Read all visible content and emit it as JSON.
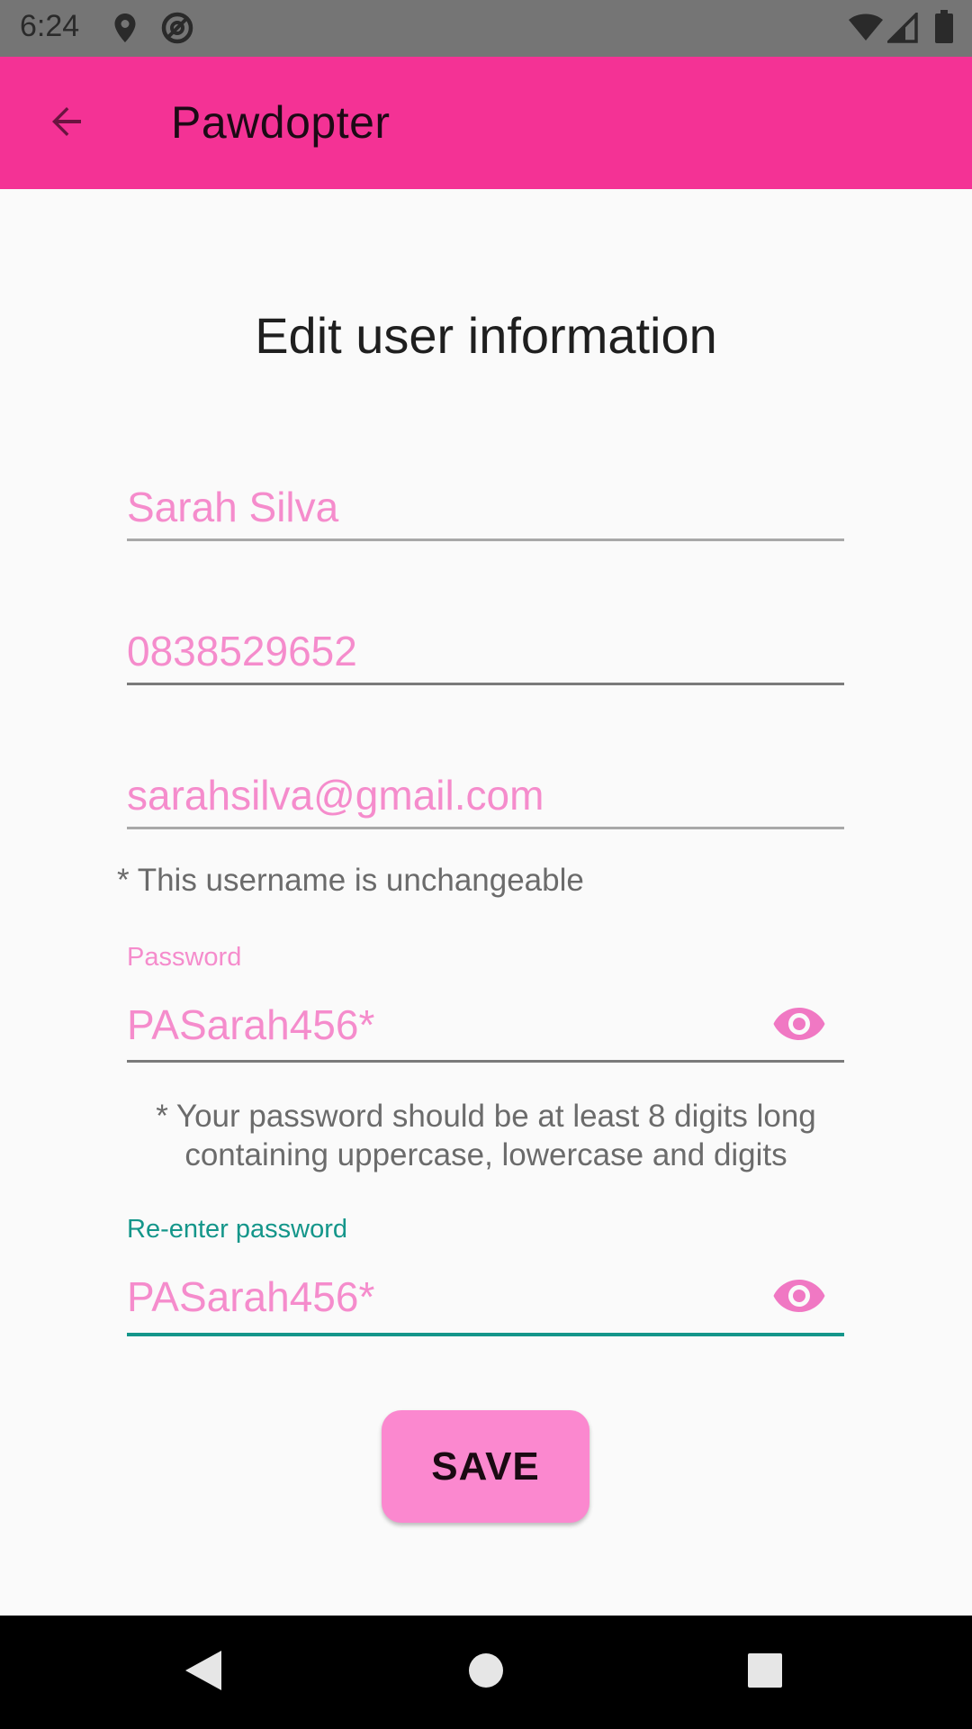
{
  "status_bar": {
    "time": "6:24",
    "icons": [
      "location-icon",
      "at-sign-icon",
      "wifi-icon",
      "signal-icon",
      "battery-icon"
    ]
  },
  "app_bar": {
    "title": "Pawdopter",
    "back_icon": "arrow-back-icon",
    "color": "#f43295"
  },
  "form": {
    "heading": "Edit user information",
    "name_value": "Sarah Silva",
    "phone_value": "0838529652",
    "email_value": "sarahsilva@gmail.com",
    "username_note": "* This username is unchangeable",
    "password_label": "Password",
    "password_value": "PASarah456*",
    "password_note": "* Your password should be at least 8 digits long containing uppercase, lowercase and digits",
    "reenter_label": "Re-enter password",
    "reenter_value": "PASarah456*",
    "save_label": "SAVE"
  },
  "colors": {
    "accent_pink": "#f58ccc",
    "focus_teal": "#14968a",
    "button_pink": "#fb88cf"
  },
  "nav_bar": {
    "icons": [
      "back-triangle-icon",
      "home-circle-icon",
      "recents-square-icon"
    ]
  }
}
